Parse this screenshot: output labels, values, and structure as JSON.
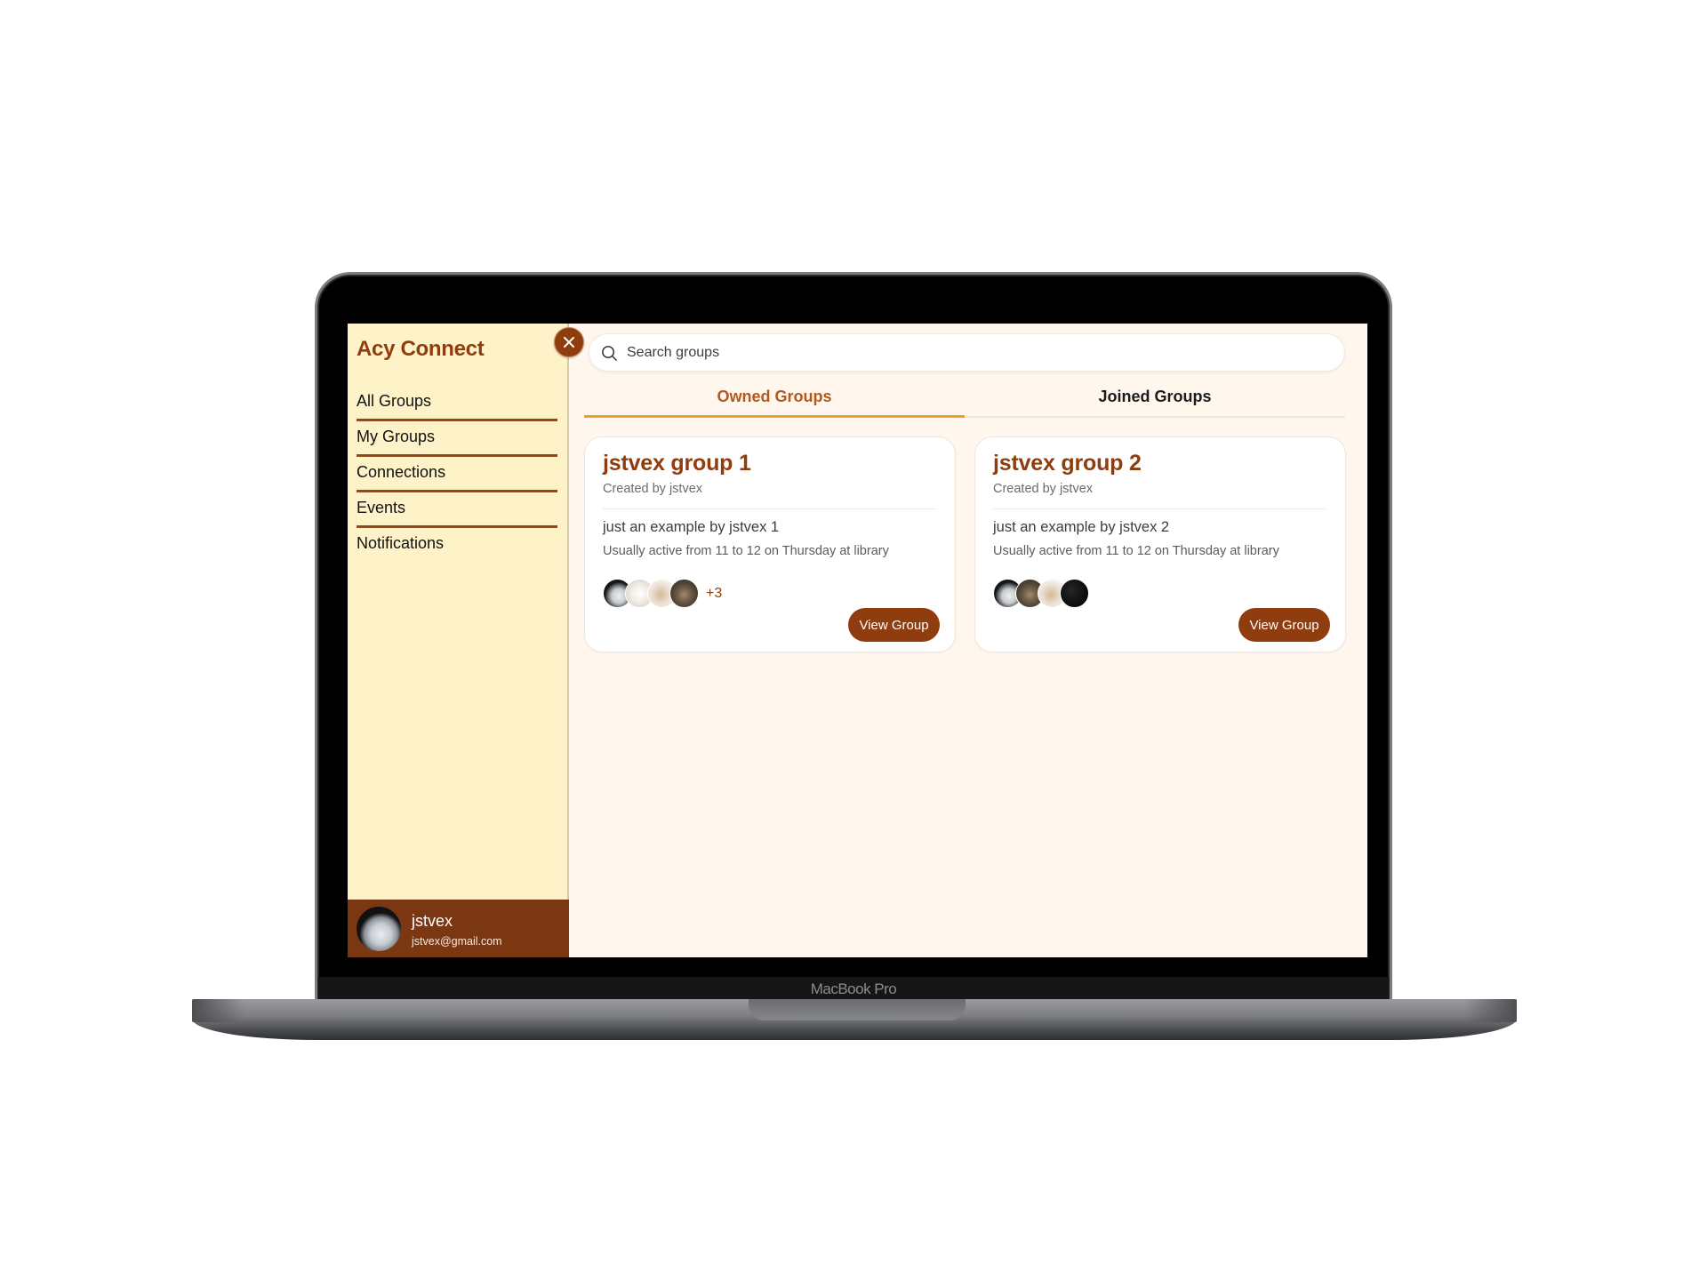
{
  "device": {
    "label": "MacBook Pro"
  },
  "app": {
    "title": "Acy Connect",
    "close_icon": "close-x-icon"
  },
  "sidebar": {
    "items": [
      {
        "label": "All Groups"
      },
      {
        "label": "My Groups"
      },
      {
        "label": "Connections"
      },
      {
        "label": "Events"
      },
      {
        "label": "Notifications"
      }
    ],
    "user": {
      "name": "jstvex",
      "email": "jstvex@gmail.com",
      "avatar": "white-cat-avatar"
    }
  },
  "search": {
    "placeholder": "Search groups",
    "value": "",
    "icon": "search-icon"
  },
  "tabs": [
    {
      "label": "Owned Groups",
      "active": true
    },
    {
      "label": "Joined Groups",
      "active": false
    }
  ],
  "groups": [
    {
      "title": "jstvex group 1",
      "creator": "Created by jstvex",
      "description": "just an example by jstvex 1",
      "activity": "Usually active from 11 to 12 on Thursday at library",
      "members": [
        "white-cat",
        "sketch",
        "cartoon",
        "tabby"
      ],
      "more_count": "+3",
      "button_label": "View Group"
    },
    {
      "title": "jstvex group 2",
      "creator": "Created by jstvex",
      "description": "just an example by jstvex 2",
      "activity": "Usually active from 11 to 12 on Thursday at library",
      "members": [
        "white-cat",
        "tabby",
        "cartoon",
        "night"
      ],
      "more_count": "",
      "button_label": "View Group"
    }
  ],
  "colors": {
    "brand": "#8f3d0e",
    "sidebar_bg": "#fef2c8",
    "main_bg": "#fff7ee",
    "tab_accent": "#f0a026",
    "footer_bg": "#7b3711"
  }
}
